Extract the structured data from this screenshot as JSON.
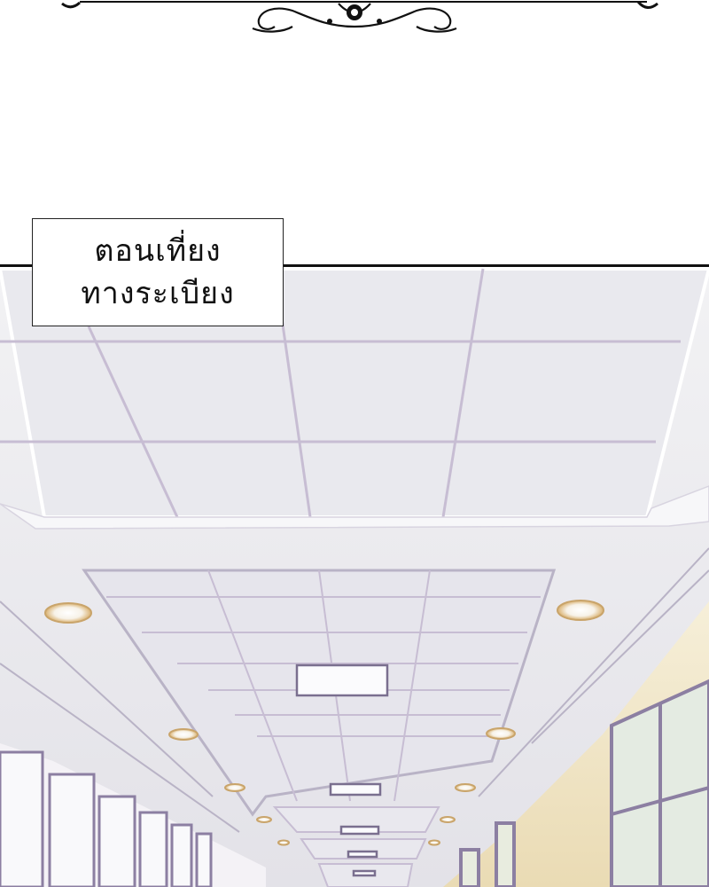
{
  "caption": {
    "line1": "ตอนเที่ยง",
    "line2": "ทางระเบียง"
  },
  "colors": {
    "ceiling": "#ededf0",
    "grid_lines": "#c7bdd3",
    "trim": "#f7f7f9",
    "wall": "#f1e8cf",
    "frame": "#8c7fa2",
    "light_warm": "#e6c58f"
  }
}
